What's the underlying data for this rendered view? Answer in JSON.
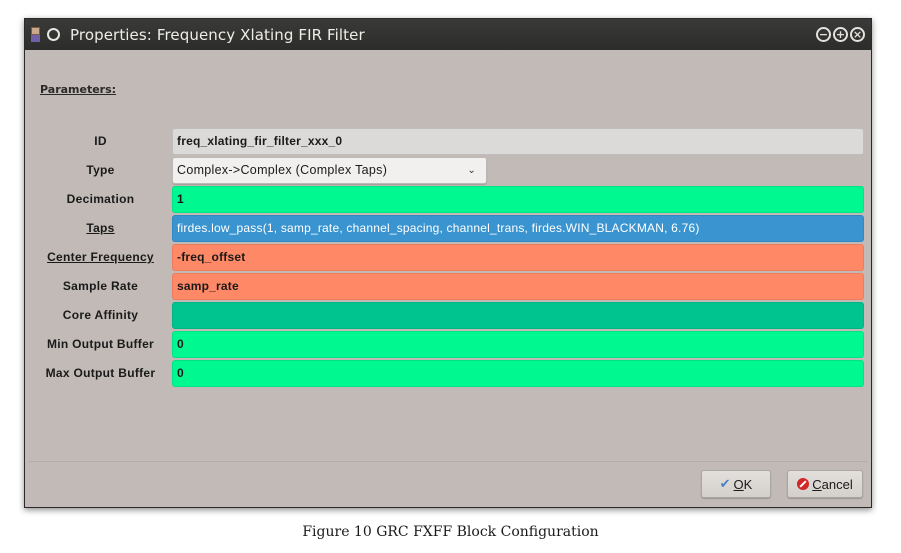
{
  "window": {
    "title": "Properties: Frequency Xlating FIR Filter",
    "controls": [
      "minimize",
      "maximize",
      "close"
    ]
  },
  "parameters_heading": "Parameters:",
  "rows": [
    {
      "label": "ID",
      "value": "freq_xlating_fir_filter_xxx_0",
      "state": "readonly",
      "color": "#dcdad8"
    },
    {
      "label": "Type",
      "value": "Complex->Complex (Complex Taps)",
      "state": "dropdown"
    },
    {
      "label": "Decimation",
      "value": "1",
      "state": "valid",
      "color": "#00f890"
    },
    {
      "label": "Taps",
      "value": "firdes.low_pass(1, samp_rate, channel_spacing, channel_trans, firdes.WIN_BLACKMAN, 6.76)",
      "state": "selected",
      "color": "#3a94d0"
    },
    {
      "label": "Center Frequency",
      "value": "-freq_offset",
      "state": "variable",
      "color": "#ff8866"
    },
    {
      "label": "Sample Rate",
      "value": "samp_rate",
      "state": "variable",
      "color": "#ff8866"
    },
    {
      "label": "Core Affinity",
      "value": "",
      "state": "empty",
      "color": "#00c490"
    },
    {
      "label": "Min Output Buffer",
      "value": "0",
      "state": "valid",
      "color": "#00f890"
    },
    {
      "label": "Max Output Buffer",
      "value": "0",
      "state": "valid",
      "color": "#00f890"
    }
  ],
  "buttons": {
    "ok_mnemonic": "O",
    "ok_rest": "K",
    "cancel_mnemonic": "C",
    "cancel_rest": "ancel"
  },
  "caption": "Figure 10 GRC FXFF Block Configuration"
}
